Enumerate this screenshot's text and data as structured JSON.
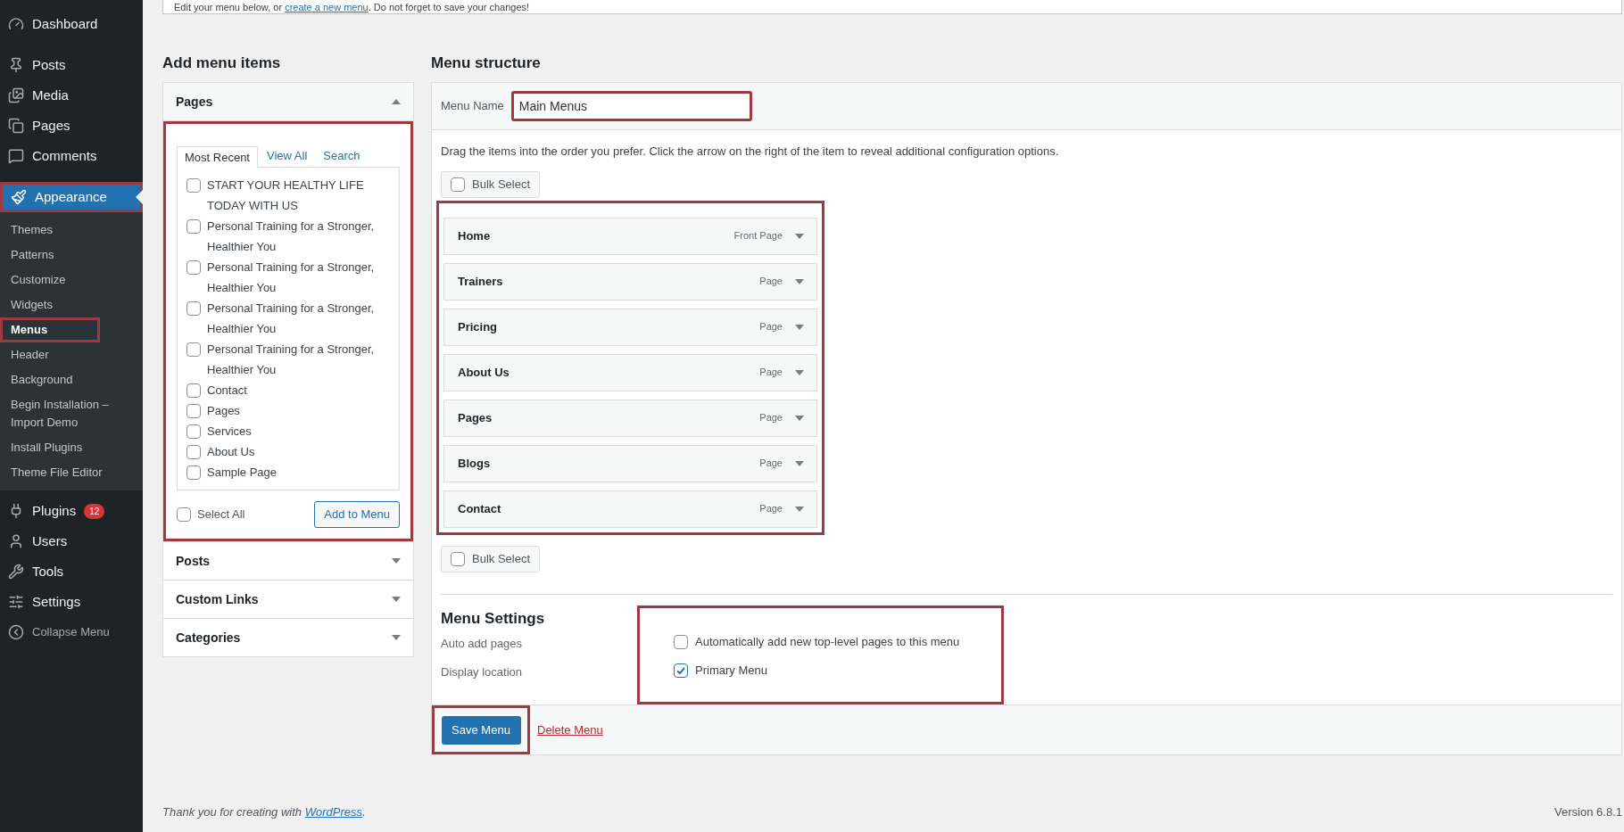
{
  "sidebar": {
    "items": [
      {
        "label": "Dashboard",
        "selected": false,
        "highlighted": false
      },
      {
        "label": "Posts",
        "selected": false,
        "highlighted": false
      },
      {
        "label": "Media",
        "selected": false,
        "highlighted": false
      },
      {
        "label": "Pages",
        "selected": false,
        "highlighted": false
      },
      {
        "label": "Comments",
        "selected": false,
        "highlighted": false
      },
      {
        "label": "Appearance",
        "selected": true,
        "highlighted": true,
        "expanded": true,
        "children": [
          {
            "label": "Themes",
            "selected": false,
            "highlighted": false
          },
          {
            "label": "Patterns",
            "selected": false,
            "highlighted": false
          },
          {
            "label": "Customize",
            "selected": false,
            "highlighted": false
          },
          {
            "label": "Widgets",
            "selected": false,
            "highlighted": false
          },
          {
            "label": "Menus",
            "selected": true,
            "highlighted": true
          },
          {
            "label": "Header",
            "selected": false,
            "highlighted": false
          },
          {
            "label": "Background",
            "selected": false,
            "highlighted": false
          },
          {
            "label": "Begin Installation – Import Demo",
            "selected": false,
            "highlighted": false
          },
          {
            "label": "Install Plugins",
            "selected": false,
            "highlighted": false
          },
          {
            "label": "Theme File Editor",
            "selected": false,
            "highlighted": false
          }
        ]
      },
      {
        "label": "Plugins",
        "selected": false,
        "highlighted": false,
        "badge": "12"
      },
      {
        "label": "Users",
        "selected": false,
        "highlighted": false
      },
      {
        "label": "Tools",
        "selected": false,
        "highlighted": false
      },
      {
        "label": "Settings",
        "selected": false,
        "highlighted": false
      },
      {
        "label": "Collapse Menu",
        "selected": false,
        "highlighted": false
      }
    ]
  },
  "notice": {
    "text_before": "Edit your menu below, or ",
    "link": "create a new menu",
    "text_after": ". Do not forget to save your changes!"
  },
  "add_menu_items": {
    "title": "Add menu items",
    "sections": [
      {
        "title": "Pages",
        "expanded": true,
        "highlighted": true,
        "tabs": [
          {
            "label": "Most Recent",
            "selected": true
          },
          {
            "label": "View All",
            "selected": false
          },
          {
            "label": "Search",
            "selected": false
          }
        ],
        "items": [
          {
            "label": "START YOUR HEALTHY LIFE TODAY WITH US",
            "checked": false
          },
          {
            "label": "Personal Training for a Stronger, Healthier You",
            "checked": false
          },
          {
            "label": "Personal Training for a Stronger, Healthier You",
            "checked": false
          },
          {
            "label": "Personal Training for a Stronger, Healthier You",
            "checked": false
          },
          {
            "label": "Personal Training for a Stronger, Healthier You",
            "checked": false
          },
          {
            "label": "Contact",
            "checked": false
          },
          {
            "label": "Pages",
            "checked": false
          },
          {
            "label": "Services",
            "checked": false
          },
          {
            "label": "About Us",
            "checked": false
          },
          {
            "label": "Sample Page",
            "checked": false
          }
        ],
        "select_all": {
          "label": "Select All",
          "checked": false
        },
        "button": "Add to Menu"
      },
      {
        "title": "Posts",
        "expanded": false
      },
      {
        "title": "Custom Links",
        "expanded": false
      },
      {
        "title": "Categories",
        "expanded": false
      }
    ]
  },
  "menu_structure": {
    "title": "Menu structure",
    "menu_name": {
      "label": "Menu Name",
      "value": "Main Menus",
      "highlighted": true
    },
    "instructions": "Drag the items into the order you prefer. Click the arrow on the right of the item to reveal additional configuration options.",
    "bulk_select_top": {
      "label": "Bulk Select",
      "checked": false
    },
    "items_highlighted": true,
    "items": [
      {
        "title": "Home",
        "type": "Front Page"
      },
      {
        "title": "Trainers",
        "type": "Page"
      },
      {
        "title": "Pricing",
        "type": "Page"
      },
      {
        "title": "About Us",
        "type": "Page"
      },
      {
        "title": "Pages",
        "type": "Page"
      },
      {
        "title": "Blogs",
        "type": "Page"
      },
      {
        "title": "Contact",
        "type": "Page"
      }
    ],
    "bulk_select_bottom": {
      "label": "Bulk Select",
      "checked": false
    },
    "settings": {
      "title": "Menu Settings",
      "highlighted": true,
      "rows": [
        {
          "label": "Auto add pages",
          "option": "Automatically add new top-level pages to this menu",
          "checked": false
        },
        {
          "label": "Display location",
          "option": "Primary Menu",
          "checked": true
        }
      ]
    },
    "save_button": {
      "label": "Save Menu",
      "highlighted": true
    },
    "delete_link": "Delete Menu"
  },
  "footer": {
    "text_before": "Thank you for creating with ",
    "link": "WordPress",
    "text_after": ".",
    "version": "Version 6.8.1"
  }
}
